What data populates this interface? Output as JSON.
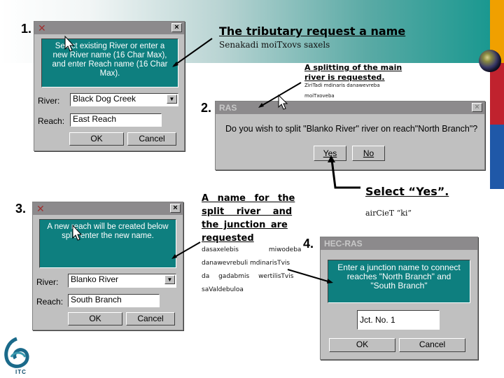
{
  "colors": {
    "teal_message": "#0e7f7f",
    "dialog_gray": "#c0c0c0",
    "title_gray": "#8c8a8c",
    "stripe_orange": "#f0a000",
    "stripe_red": "#c0222e",
    "stripe_blue": "#1f58a8"
  },
  "steps": {
    "one": "1.",
    "two": "2.",
    "three": "3.",
    "four": "4."
  },
  "dialog1": {
    "title": "",
    "message": "Select existing River or enter a new River name (16 Char Max), and enter Reach name (16 Char Max).",
    "river_label": "River:",
    "river_value": "Black Dog Creek",
    "reach_label": "Reach:",
    "reach_value": "East Reach",
    "ok": "OK",
    "cancel": "Cancel",
    "close": "×"
  },
  "dialog2": {
    "title": "RAS",
    "message": "Do you wish to split \"Blanko River\" river on reach\"North Branch\"?",
    "yes": "Yes",
    "no": "No",
    "close": "×"
  },
  "dialog3": {
    "title": "",
    "message": "A new reach will be created below split, enter the new name.",
    "river_label": "River:",
    "river_value": "Blanko River",
    "reach_label": "Reach:",
    "reach_value": "South Branch",
    "ok": "OK",
    "cancel": "Cancel",
    "close": "×"
  },
  "dialog4": {
    "title": "HEC-RAS",
    "message": "Enter a junction name to connect reaches \"North Branch\" and \"South Branch\"",
    "junction_value": "Jct. No. 1",
    "ok": "OK",
    "cancel": "Cancel"
  },
  "annotations": {
    "tributary_title": "The tributary request a name",
    "tributary_sub": "Senakadi moiTxovs saxels",
    "split_title_1": "A splitting of the main",
    "split_title_2": "river is requested.",
    "split_sub_1": "ZiriTadi mdinaris danawevreba",
    "split_sub_2": "moiTxoveba",
    "select_yes_title": "Select “Yes”.",
    "select_yes_sub": "airCieT “ki”",
    "name_title_1": "A name for the",
    "name_title_2": "split river and",
    "name_title_3": "the junction are",
    "name_title_4": "requested",
    "name_sub_1": "dasaxelebis miwodeba",
    "name_sub_2": "danawevrebuli mdinarisTvis",
    "name_sub_3": "da gadabmis wertilisTvis",
    "name_sub_4": "saValdebuloa"
  },
  "logo": {
    "text": "ITC"
  }
}
